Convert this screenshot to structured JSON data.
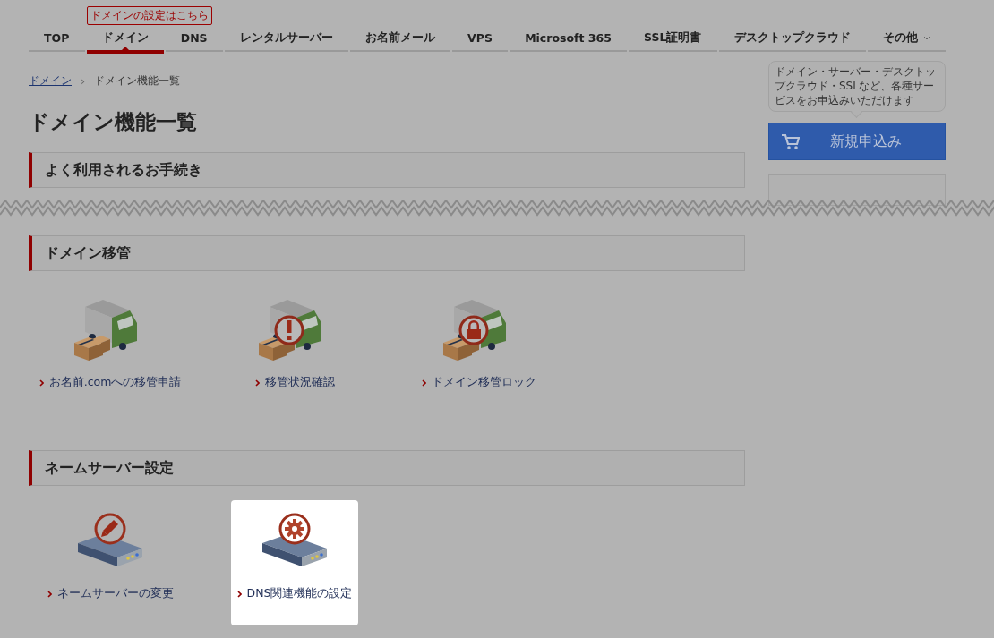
{
  "nav": [
    {
      "label": "TOP",
      "selected": false
    },
    {
      "label": "ドメイン",
      "selected": true,
      "tooltip": "ドメインの設定はこちら"
    },
    {
      "label": "DNS",
      "selected": false
    },
    {
      "label": "レンタルサーバー",
      "selected": false
    },
    {
      "label": "お名前メール",
      "selected": false
    },
    {
      "label": "VPS",
      "selected": false
    },
    {
      "label": "Microsoft 365",
      "selected": false
    },
    {
      "label": "SSL証明書",
      "selected": false
    },
    {
      "label": "デスクトップクラウド",
      "selected": false
    },
    {
      "label": "その他",
      "selected": false,
      "dropdown": true
    }
  ],
  "breadcrumb": {
    "separator": "›",
    "items": [
      {
        "label": "ドメイン",
        "link": true
      },
      {
        "label": "ドメイン機能一覧",
        "link": false
      }
    ]
  },
  "title": "ドメイン機能一覧",
  "upper": {
    "sections": [
      {
        "heading": "よく利用されるお手続き"
      }
    ]
  },
  "sidebar": {
    "bubble": "ドメイン・サーバー・デスクトップクラウド・SSLなど、各種サービスをお申込みいただけます",
    "button": "新規申込み"
  },
  "lower": {
    "sections": [
      {
        "heading": "ドメイン移管",
        "items": [
          {
            "kind": "truck",
            "label": "お名前.comへの移管申請",
            "highlighted": false
          },
          {
            "kind": "truck-alert",
            "label": "移管状況確認",
            "highlighted": false
          },
          {
            "kind": "truck-lock",
            "label": "ドメイン移管ロック",
            "highlighted": false
          }
        ]
      },
      {
        "heading": "ネームサーバー設定",
        "items": [
          {
            "kind": "server-edit",
            "label": "ネームサーバーの変更",
            "highlighted": false
          },
          {
            "kind": "server-gear",
            "label": "DNS関連機能の設定",
            "highlighted": true
          }
        ]
      }
    ]
  }
}
